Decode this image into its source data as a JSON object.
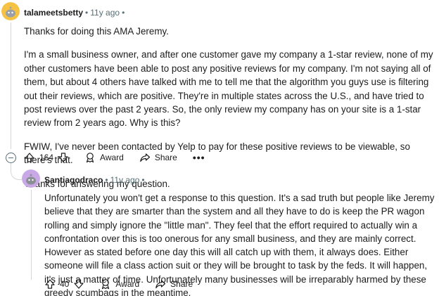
{
  "parent": {
    "username": "talameetsbetty",
    "time": "11y ago",
    "paragraphs": [
      "Thanks for doing this AMA Jeremy.",
      "I'm a small business owner, and after one customer gave my company a 1-star review, none of my other customers have been able to post any positive reviews for my company. I'm not saying all of them, but about 4 others have talked with me to tell me that the algorithm you guys use is filtering out their reviews, which are positive. They're in multiple states across the U.S., and have tried to post reviews over the past 2 years. So, the only review my company has on your site is a 1-star review from 2 years ago. Why is this?",
      "FWIW, I've never been contacted by Yelp to pay for these positive reviews to be viewable, so there's that.",
      "Thanks for answering my question."
    ],
    "votes": "164",
    "award_label": "Award",
    "share_label": "Share",
    "more_label": "•••"
  },
  "reply": {
    "username": "Santiagodraco",
    "time": "11y ago",
    "paragraphs": [
      "Unfortunately you won't get a response to this question. It's a sad truth but people like Jeremy believe that they are smarter than the system and all they have to do is keep the PR wagon rolling and simply ignore the \"little man\". They feel that the effort required to actually win a confrontation over this is too onerous for any small business, and they are mainly correct. However as stated before one day this will all catch up with them, it always does. Either someone will file a class action suit or they will be brought to task by the feds. It will happen, it's just a matter of time. Unfortunately many businesses will be irreparably harmed by these greedy scumbags in the meantime."
    ],
    "votes": "40",
    "award_label": "Award",
    "share_label": "Share"
  },
  "separator_dot": "•",
  "colors": {
    "avatar_parent": "#f6c244",
    "avatar_reply": "#c9a8e6",
    "meta_gray": "#576f76",
    "thread_line": "#d4d7d9"
  },
  "icons": [
    "upvote-icon",
    "downvote-icon",
    "award-icon",
    "share-icon",
    "collapse-icon",
    "snoo-avatar-icon"
  ]
}
